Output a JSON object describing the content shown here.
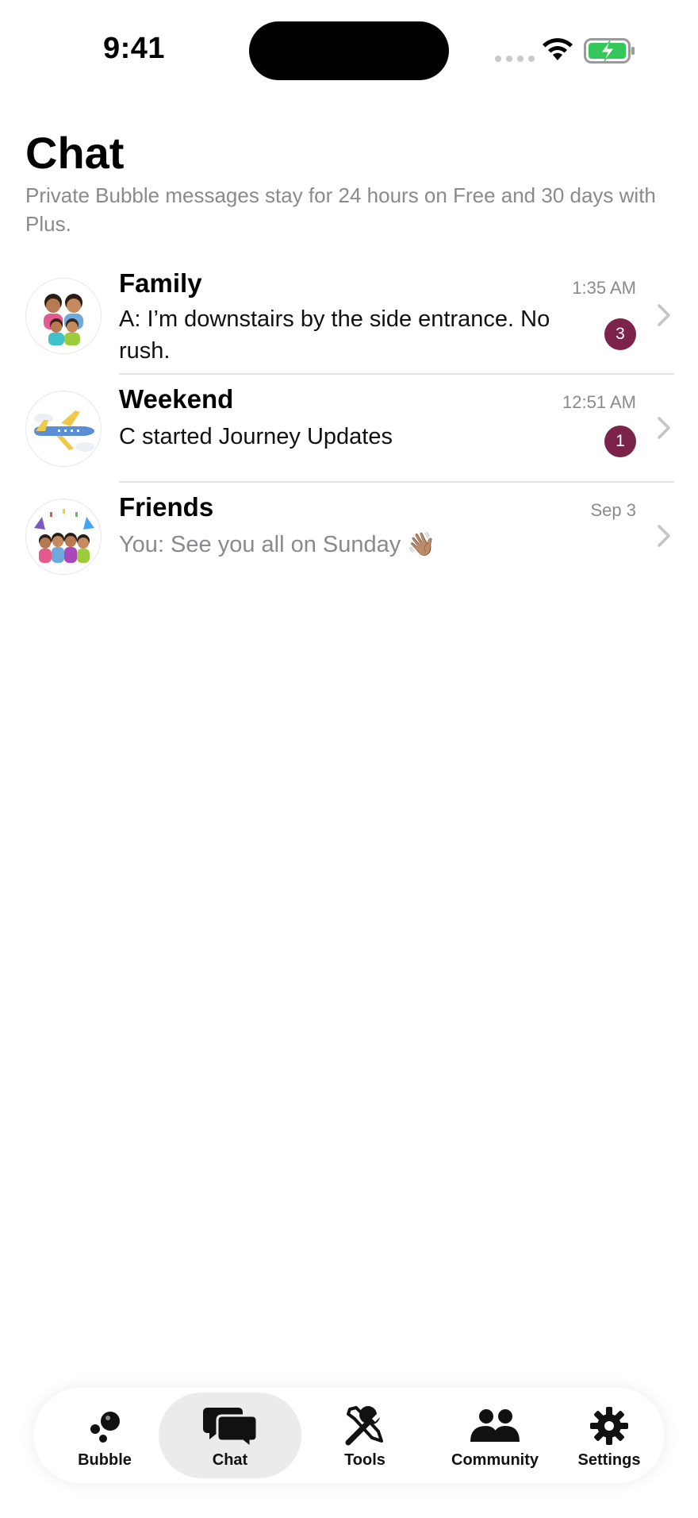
{
  "status_bar": {
    "time": "9:41"
  },
  "header": {
    "title": "Chat",
    "subtitle": "Private Bubble messages stay for 24 hours on Free and 30 days with Plus."
  },
  "chats": [
    {
      "name": "Family",
      "message": "A: I’m downstairs by the side entrance. No rush.",
      "time": "1:35 AM",
      "unread": "3",
      "avatar": "family-avatar"
    },
    {
      "name": "Weekend",
      "message": "C started Journey Updates",
      "time": "12:51 AM",
      "unread": "1",
      "avatar": "airplane-avatar"
    },
    {
      "name": "Friends",
      "message": "You: See you all on Sunday 👋🏽",
      "time": "Sep 3",
      "unread": "",
      "avatar": "friends-party-avatar"
    }
  ],
  "tabs": [
    {
      "label": "Bubble",
      "icon": "bubbles-icon",
      "active": false
    },
    {
      "label": "Chat",
      "icon": "chat-bubbles-icon",
      "active": true
    },
    {
      "label": "Tools",
      "icon": "tools-icon",
      "active": false
    },
    {
      "label": "Community",
      "icon": "people-icon",
      "active": false
    },
    {
      "label": "Settings",
      "icon": "gear-icon",
      "active": false
    }
  ],
  "colors": {
    "badge": "#7b2349",
    "muted_text": "#8a8a8e",
    "active_tab_bg": "#ebebeb",
    "battery": "#34c759"
  }
}
